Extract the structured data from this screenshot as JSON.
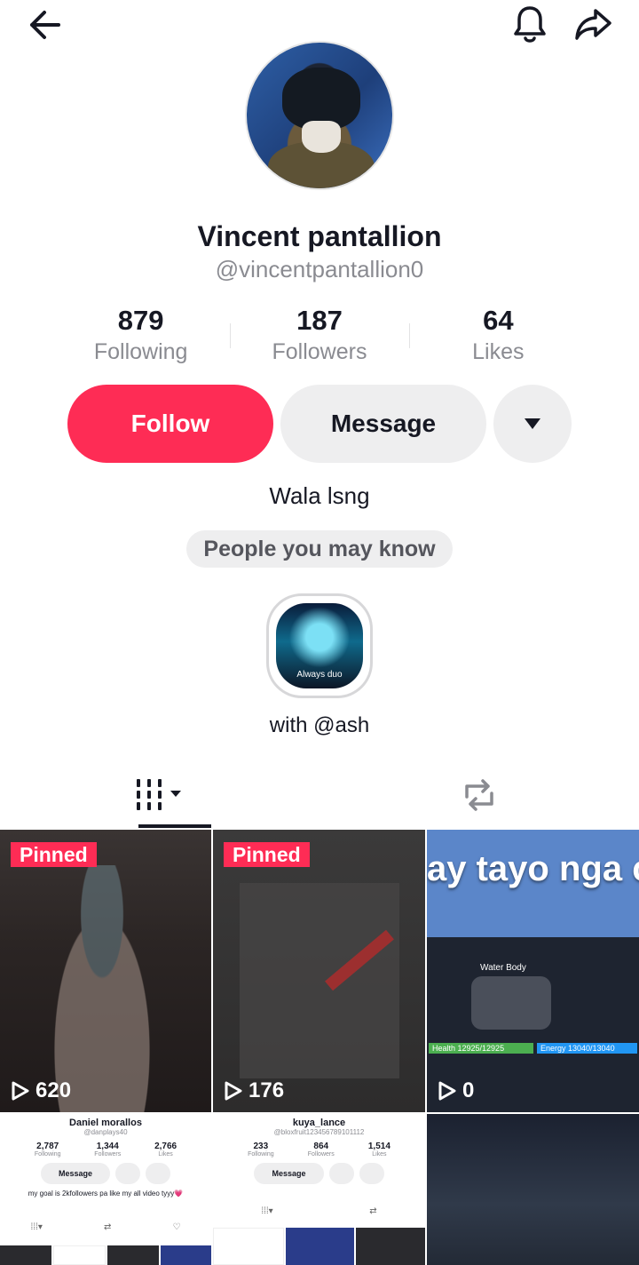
{
  "profile": {
    "name": "Vincent pantallion",
    "handle": "@vincentpantallion0",
    "bio": "Wala lsng"
  },
  "stats": [
    {
      "value": "879",
      "label": "Following"
    },
    {
      "value": "187",
      "label": "Followers"
    },
    {
      "value": "64",
      "label": "Likes"
    }
  ],
  "actions": {
    "follow": "Follow",
    "message": "Message"
  },
  "suggest_label": "People you may know",
  "collab": {
    "thumb_caption": "Always duo",
    "with_label": "with @ash"
  },
  "videos": [
    {
      "pinned": "Pinned",
      "views": "620"
    },
    {
      "pinned": "Pinned",
      "views": "176"
    },
    {
      "overlay_text": "ay tayo nga count ako",
      "views": "0",
      "body_label": "Water Body",
      "health": "Health 12925/12925",
      "energy": "Energy 13040/13040"
    },
    {
      "name": "Daniel morallos",
      "handle": "@danplays40",
      "stats": [
        {
          "v": "2,787",
          "l": "Following"
        },
        {
          "v": "1,344",
          "l": "Followers"
        },
        {
          "v": "2,766",
          "l": "Likes"
        }
      ],
      "button": "Message",
      "bio": "my goal is 2kfollowers pa like my all video tyyy💗"
    },
    {
      "name": "kuya_lance",
      "handle": "@bloxfruit123456789101112",
      "stats": [
        {
          "v": "233",
          "l": "Following"
        },
        {
          "v": "864",
          "l": "Followers"
        },
        {
          "v": "1,514",
          "l": "Likes"
        }
      ],
      "button": "Message"
    }
  ],
  "colors": {
    "accent": "#fe2c55",
    "text_primary": "#161823",
    "text_secondary": "#8a8b91",
    "button_gray": "#eeeeef"
  },
  "icons": [
    "back-arrow-icon",
    "bell-icon",
    "share-icon",
    "dropdown-triangle-icon",
    "grid-icon",
    "repost-icon",
    "play-icon"
  ]
}
